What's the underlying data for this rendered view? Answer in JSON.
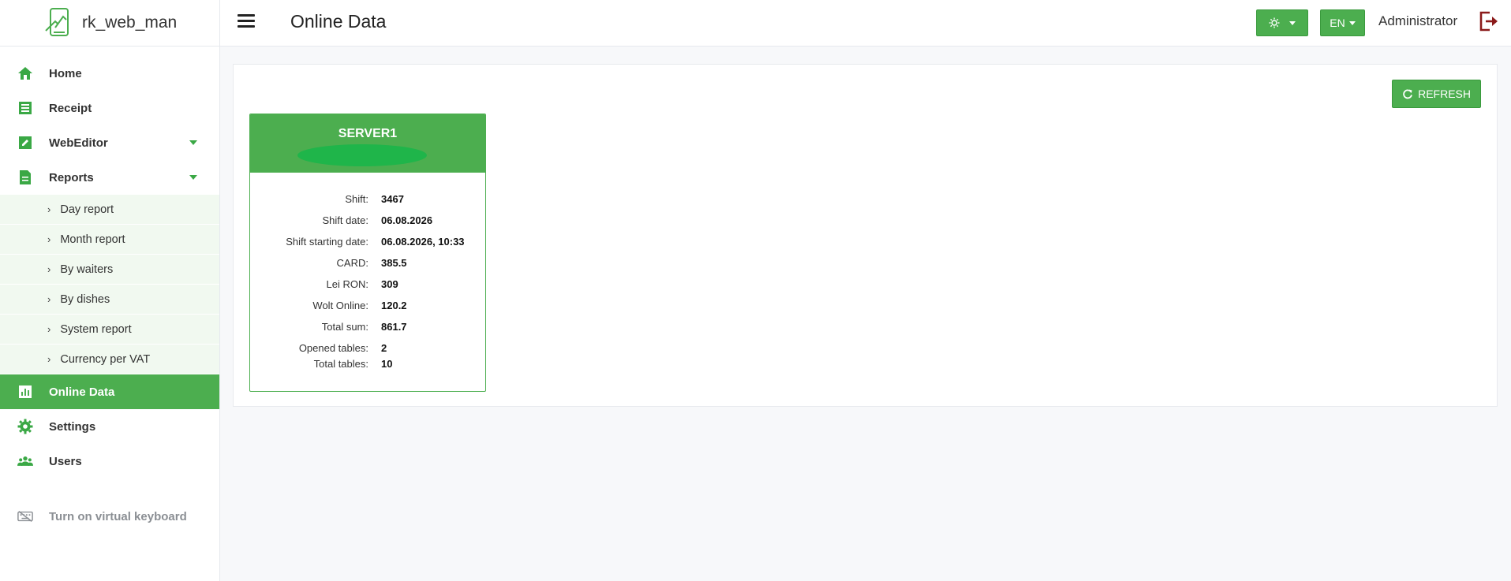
{
  "app": {
    "name": "rk_web_man"
  },
  "header": {
    "title": "Online Data",
    "lang": "EN",
    "user": "Administrator"
  },
  "colors": {
    "accent": "#4cae4f",
    "logout": "#8b1a1a"
  },
  "sidebar": {
    "items": [
      {
        "label": "Home",
        "icon": "home-icon"
      },
      {
        "label": "Receipt",
        "icon": "receipt-icon"
      },
      {
        "label": "WebEditor",
        "icon": "edit-icon"
      },
      {
        "label": "Reports",
        "icon": "reports-icon"
      },
      {
        "label": "Online Data",
        "icon": "chart-icon"
      },
      {
        "label": "Settings",
        "icon": "gear-icon"
      },
      {
        "label": "Users",
        "icon": "users-icon"
      }
    ],
    "reports_sub": [
      {
        "label": "Day report"
      },
      {
        "label": "Month report"
      },
      {
        "label": "By waiters"
      },
      {
        "label": "By dishes"
      },
      {
        "label": "System report"
      },
      {
        "label": "Currency per VAT"
      }
    ],
    "keyboard": "Turn on virtual keyboard"
  },
  "main": {
    "refresh_label": "REFRESH",
    "server": {
      "name": "SERVER1",
      "fields": [
        {
          "label": "Shift:",
          "value": "3467"
        },
        {
          "label": "Shift date:",
          "value": "06.08.2026"
        },
        {
          "label": "Shift starting date:",
          "value": "06.08.2026, 10:33"
        },
        {
          "label": "CARD:",
          "value": "385.5"
        },
        {
          "label": "Lei RON:",
          "value": "309"
        },
        {
          "label": "Wolt Online:",
          "value": "120.2"
        },
        {
          "label": "Total sum:",
          "value": "861.7"
        },
        {
          "label": "Opened tables:",
          "value": "2"
        },
        {
          "label": "Total tables:",
          "value": "10"
        }
      ]
    }
  }
}
